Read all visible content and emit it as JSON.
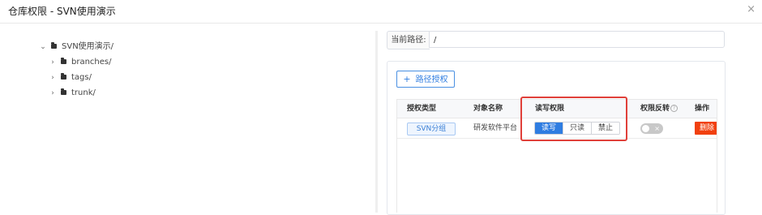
{
  "dialog": {
    "title": "仓库权限 - SVN使用演示",
    "close_glyph": "×"
  },
  "tree": {
    "root": {
      "label": "SVN使用演示/",
      "expanded": true,
      "chevron": "⌄"
    },
    "children": [
      {
        "label": "branches/",
        "chevron": "›"
      },
      {
        "label": "tags/",
        "chevron": "›"
      },
      {
        "label": "trunk/",
        "chevron": "›"
      }
    ]
  },
  "path": {
    "label": "当前路径:",
    "value": "/"
  },
  "toolbar": {
    "add_glyph": "+",
    "add_label": "路径授权"
  },
  "table": {
    "headers": {
      "type": "授权类型",
      "object": "对象名称",
      "rw": "读写权限",
      "invert": "权限反转",
      "help_glyph": "?",
      "actions": "操作"
    },
    "rows": [
      {
        "type": "SVN分组",
        "object": "研发软件平台",
        "rw_options": [
          "读写",
          "只读",
          "禁止"
        ],
        "rw_selected": "读写",
        "invert_on": false,
        "invert_glyph": "×",
        "delete_label": "删除"
      }
    ]
  },
  "colors": {
    "primary": "#2f7de1",
    "danger": "#f1400f",
    "highlight": "#e0403a"
  }
}
